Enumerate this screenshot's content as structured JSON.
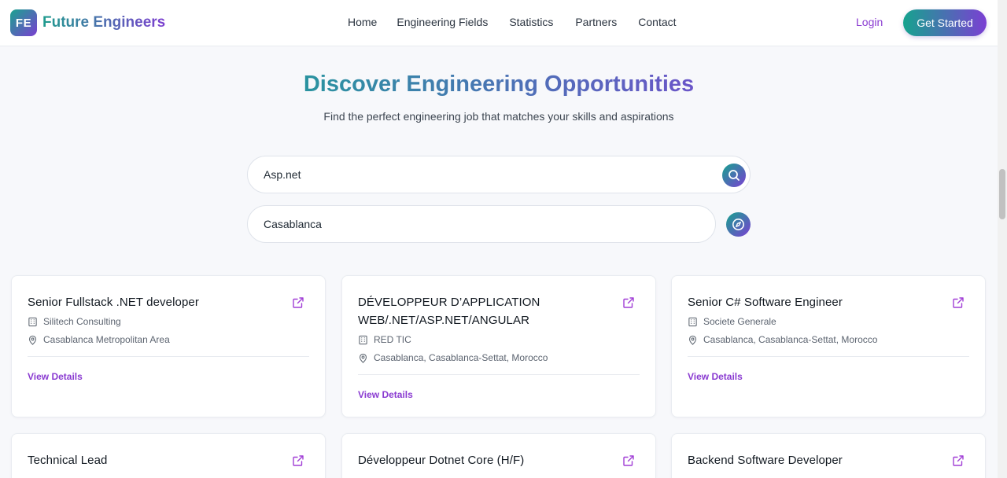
{
  "brand": {
    "logo_initials": "FE",
    "name": "Future Engineers",
    "gradient_start": "#16a38e",
    "gradient_end": "#7b3fd3"
  },
  "nav": {
    "links": [
      "Home",
      "Engineering Fields",
      "Statistics",
      "Partners",
      "Contact"
    ],
    "login_label": "Login",
    "cta_label": "Get Started"
  },
  "hero": {
    "title": "Discover Engineering Opportunities",
    "subtitle": "Find the perfect engineering job that matches your skills and aspirations"
  },
  "search": {
    "query": "Asp.net",
    "location": "Casablanca",
    "search_icon": "search-icon",
    "locate_icon": "compass-icon"
  },
  "jobs": [
    {
      "title": "Senior Fullstack .NET developer",
      "company": "Silitech Consulting",
      "location": "Casablanca Metropolitan Area",
      "action": "View Details"
    },
    {
      "title": "DÉVELOPPEUR D’APPLICATION WEB/.NET/ASP.NET/ANGULAR",
      "company": "RED TIC",
      "location": "Casablanca, Casablanca-Settat, Morocco",
      "action": "View Details"
    },
    {
      "title": "Senior C# Software Engineer",
      "company": "Societe Generale",
      "location": "Casablanca, Casablanca-Settat, Morocco",
      "action": "View Details"
    },
    {
      "title": "Technical Lead"
    },
    {
      "title": "Développeur Dotnet Core (H/F)"
    },
    {
      "title": "Backend Software Developer"
    }
  ]
}
